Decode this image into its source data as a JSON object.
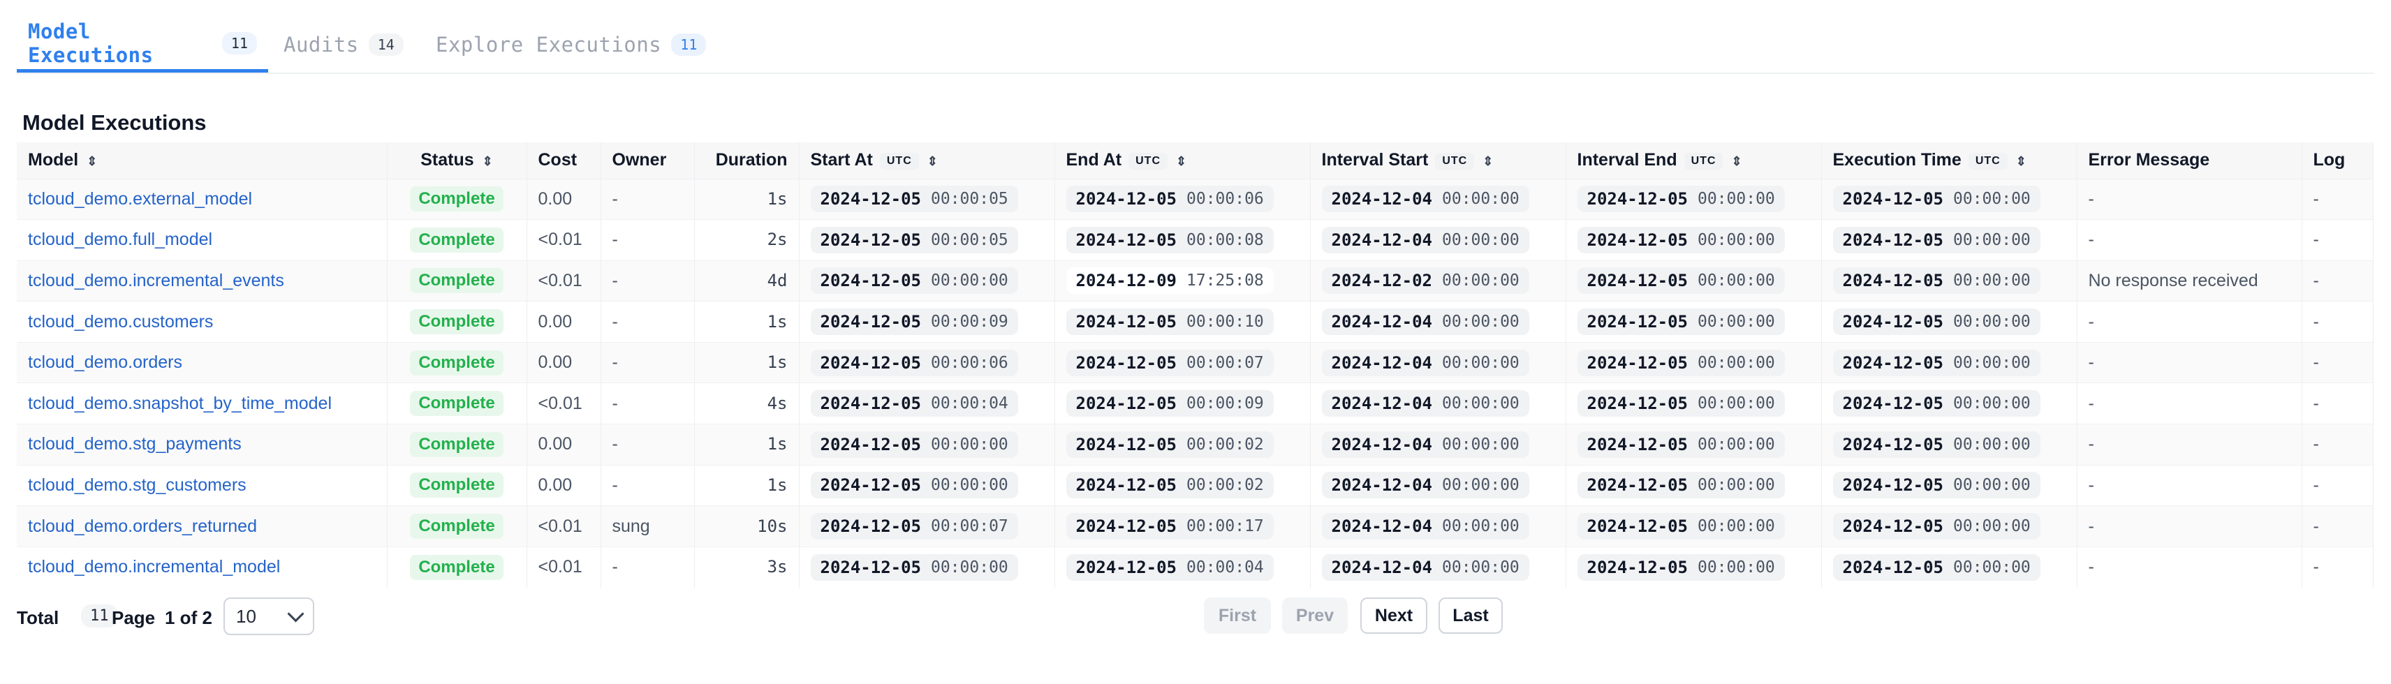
{
  "tabs": [
    {
      "label": "Model Executions",
      "count": "11"
    },
    {
      "label": "Audits",
      "count": "14"
    },
    {
      "label": "Explore Executions",
      "count": "11"
    }
  ],
  "section_title": "Model Executions",
  "table": {
    "headers": {
      "model": "Model",
      "status": "Status",
      "cost": "Cost",
      "owner": "Owner",
      "duration": "Duration",
      "start_at": "Start At",
      "end_at": "End At",
      "interval_start": "Interval Start",
      "interval_end": "Interval End",
      "execution_time": "Execution Time",
      "error_message": "Error Message",
      "log": "Log",
      "utc_badge": "UTC"
    },
    "rows": [
      {
        "model": "tcloud_demo.external_model",
        "status": "Complete",
        "cost": "0.00",
        "owner": "-",
        "duration": "1s",
        "start_d": "2024-12-05",
        "start_t": "00:00:05",
        "end_d": "2024-12-05",
        "end_t": "00:00:06",
        "is_d": "2024-12-04",
        "is_t": "00:00:00",
        "ie_d": "2024-12-05",
        "ie_t": "00:00:00",
        "ex_d": "2024-12-05",
        "ex_t": "00:00:00",
        "error": "-",
        "log": "-"
      },
      {
        "model": "tcloud_demo.full_model",
        "status": "Complete",
        "cost": "<0.01",
        "owner": "-",
        "duration": "2s",
        "start_d": "2024-12-05",
        "start_t": "00:00:05",
        "end_d": "2024-12-05",
        "end_t": "00:00:08",
        "is_d": "2024-12-04",
        "is_t": "00:00:00",
        "ie_d": "2024-12-05",
        "ie_t": "00:00:00",
        "ex_d": "2024-12-05",
        "ex_t": "00:00:00",
        "error": "-",
        "log": "-"
      },
      {
        "model": "tcloud_demo.incremental_events",
        "status": "Complete",
        "cost": "<0.01",
        "owner": "-",
        "duration": "4d",
        "start_d": "2024-12-05",
        "start_t": "00:00:00",
        "end_d": "2024-12-09",
        "end_t": "17:25:08",
        "is_d": "2024-12-02",
        "is_t": "00:00:00",
        "ie_d": "2024-12-05",
        "ie_t": "00:00:00",
        "ex_d": "2024-12-05",
        "ex_t": "00:00:00",
        "error": "No response received",
        "log": "-"
      },
      {
        "model": "tcloud_demo.customers",
        "status": "Complete",
        "cost": "0.00",
        "owner": "-",
        "duration": "1s",
        "start_d": "2024-12-05",
        "start_t": "00:00:09",
        "end_d": "2024-12-05",
        "end_t": "00:00:10",
        "is_d": "2024-12-04",
        "is_t": "00:00:00",
        "ie_d": "2024-12-05",
        "ie_t": "00:00:00",
        "ex_d": "2024-12-05",
        "ex_t": "00:00:00",
        "error": "-",
        "log": "-"
      },
      {
        "model": "tcloud_demo.orders",
        "status": "Complete",
        "cost": "0.00",
        "owner": "-",
        "duration": "1s",
        "start_d": "2024-12-05",
        "start_t": "00:00:06",
        "end_d": "2024-12-05",
        "end_t": "00:00:07",
        "is_d": "2024-12-04",
        "is_t": "00:00:00",
        "ie_d": "2024-12-05",
        "ie_t": "00:00:00",
        "ex_d": "2024-12-05",
        "ex_t": "00:00:00",
        "error": "-",
        "log": "-"
      },
      {
        "model": "tcloud_demo.snapshot_by_time_model",
        "status": "Complete",
        "cost": "<0.01",
        "owner": "-",
        "duration": "4s",
        "start_d": "2024-12-05",
        "start_t": "00:00:04",
        "end_d": "2024-12-05",
        "end_t": "00:00:09",
        "is_d": "2024-12-04",
        "is_t": "00:00:00",
        "ie_d": "2024-12-05",
        "ie_t": "00:00:00",
        "ex_d": "2024-12-05",
        "ex_t": "00:00:00",
        "error": "-",
        "log": "-"
      },
      {
        "model": "tcloud_demo.stg_payments",
        "status": "Complete",
        "cost": "0.00",
        "owner": "-",
        "duration": "1s",
        "start_d": "2024-12-05",
        "start_t": "00:00:00",
        "end_d": "2024-12-05",
        "end_t": "00:00:02",
        "is_d": "2024-12-04",
        "is_t": "00:00:00",
        "ie_d": "2024-12-05",
        "ie_t": "00:00:00",
        "ex_d": "2024-12-05",
        "ex_t": "00:00:00",
        "error": "-",
        "log": "-"
      },
      {
        "model": "tcloud_demo.stg_customers",
        "status": "Complete",
        "cost": "0.00",
        "owner": "-",
        "duration": "1s",
        "start_d": "2024-12-05",
        "start_t": "00:00:00",
        "end_d": "2024-12-05",
        "end_t": "00:00:02",
        "is_d": "2024-12-04",
        "is_t": "00:00:00",
        "ie_d": "2024-12-05",
        "ie_t": "00:00:00",
        "ex_d": "2024-12-05",
        "ex_t": "00:00:00",
        "error": "-",
        "log": "-"
      },
      {
        "model": "tcloud_demo.orders_returned",
        "status": "Complete",
        "cost": "<0.01",
        "owner": "sung",
        "duration": "10s",
        "start_d": "2024-12-05",
        "start_t": "00:00:07",
        "end_d": "2024-12-05",
        "end_t": "00:00:17",
        "is_d": "2024-12-04",
        "is_t": "00:00:00",
        "ie_d": "2024-12-05",
        "ie_t": "00:00:00",
        "ex_d": "2024-12-05",
        "ex_t": "00:00:00",
        "error": "-",
        "log": "-"
      },
      {
        "model": "tcloud_demo.incremental_model",
        "status": "Complete",
        "cost": "<0.01",
        "owner": "-",
        "duration": "3s",
        "start_d": "2024-12-05",
        "start_t": "00:00:00",
        "end_d": "2024-12-05",
        "end_t": "00:00:04",
        "is_d": "2024-12-04",
        "is_t": "00:00:00",
        "ie_d": "2024-12-05",
        "ie_t": "00:00:00",
        "ex_d": "2024-12-05",
        "ex_t": "00:00:00",
        "error": "-",
        "log": "-"
      }
    ]
  },
  "footer": {
    "total_label": "Total",
    "total_count": "11",
    "page_label": "Page",
    "page_value": "1 of 2",
    "page_size": "10",
    "buttons": {
      "first": "First",
      "prev": "Prev",
      "next": "Next",
      "last": "Last"
    }
  },
  "colors": {
    "accent": "#2f80ed",
    "link": "#2563c9",
    "status_complete": "#22b14c"
  },
  "icons": {
    "sort": "sort-icon",
    "dropdown": "chevron-down-icon"
  }
}
